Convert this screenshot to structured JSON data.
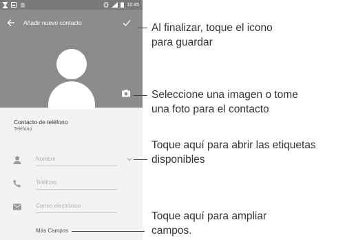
{
  "status_bar": {
    "time": "10:45"
  },
  "app_bar": {
    "title": "Añadir nuevo contacto"
  },
  "section": {
    "title": "Contacto de teléfono",
    "subtitle": "Teléfono"
  },
  "fields": {
    "name_placeholder": "Nombre",
    "phone_placeholder": "Teléfono",
    "email_placeholder": "Correo electrónico"
  },
  "more_fields": "Más Campos",
  "callouts": {
    "save": [
      "Al finalizar, toque el icono",
      "para guardar"
    ],
    "photo": [
      "Seleccione una imagen o tome",
      "una foto para el contacto"
    ],
    "labels": [
      "Toque aquí para abrir las etiquetas",
      "disponibles"
    ],
    "expand": [
      "Toque aquí para ampliar",
      "campos."
    ]
  },
  "colors": {
    "header": "#8c8c8c",
    "statusbar": "#7a7a7a",
    "body": "#f2f2f2",
    "icon": "#9a9a9a"
  },
  "icons": [
    "back-arrow-icon",
    "check-icon",
    "camera-icon",
    "person-icon",
    "phone-icon",
    "mail-icon",
    "chevron-down-icon"
  ]
}
